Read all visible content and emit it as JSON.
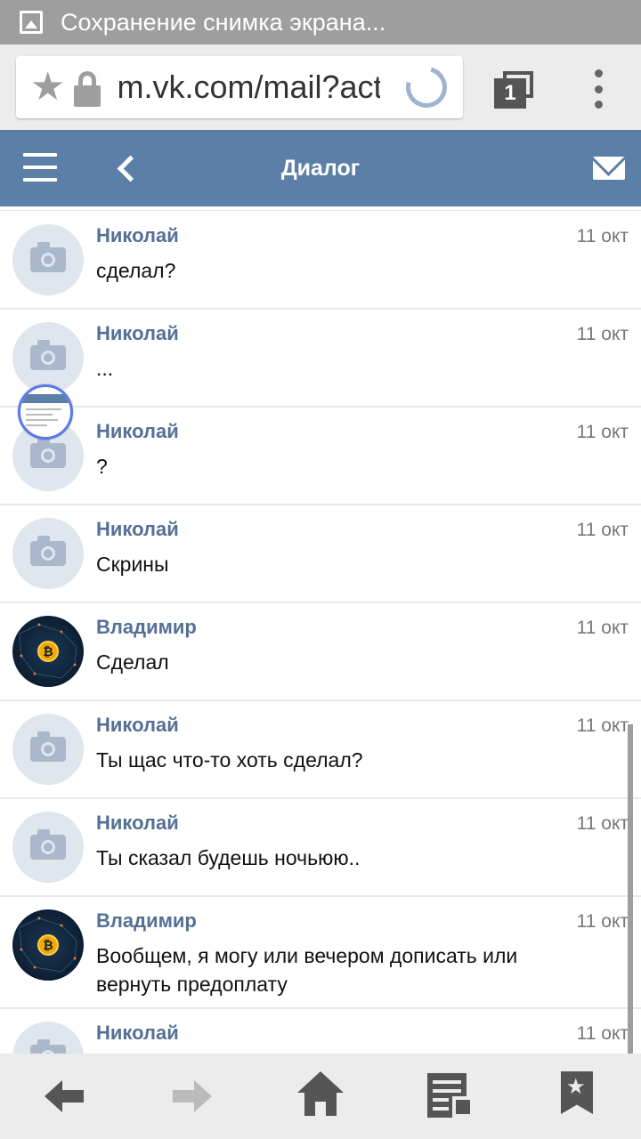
{
  "status_bar": {
    "title": "Сохранение снимка экрана..."
  },
  "browser": {
    "url": "m.vk.com/mail?act",
    "tab_count": "1"
  },
  "header": {
    "title": "Диалог"
  },
  "messages": [
    {
      "author": "Николай",
      "date": "11 окт",
      "text": "сделал?",
      "avatar": "camera-placeholder"
    },
    {
      "author": "Николай",
      "date": "11 окт",
      "text": "...",
      "avatar": "camera-placeholder"
    },
    {
      "author": "Николай",
      "date": "11 окт",
      "text": "?",
      "avatar": "camera-placeholder"
    },
    {
      "author": "Николай",
      "date": "11 окт",
      "text": "Скрины",
      "avatar": "camera-placeholder"
    },
    {
      "author": "Владимир",
      "date": "11 окт",
      "text": "Сделал",
      "avatar": "bitcoin-avatar"
    },
    {
      "author": "Николай",
      "date": "11 окт",
      "text": "Ты щас что-то хоть сделал?",
      "avatar": "camera-placeholder"
    },
    {
      "author": "Николай",
      "date": "11 окт",
      "text": "Ты сказал будешь ночьюю..",
      "avatar": "camera-placeholder"
    },
    {
      "author": "Владимир",
      "date": "11 окт",
      "text": "Вообщем, я могу или вечером дописать или вернуть предоплату",
      "avatar": "bitcoin-avatar"
    },
    {
      "author": "Николай",
      "date": "11 окт",
      "text": "",
      "avatar": "camera-placeholder"
    }
  ],
  "colors": {
    "vk_header": "#5b7fa6",
    "author_name": "#557096",
    "status_bar": "#9e9e9e"
  }
}
